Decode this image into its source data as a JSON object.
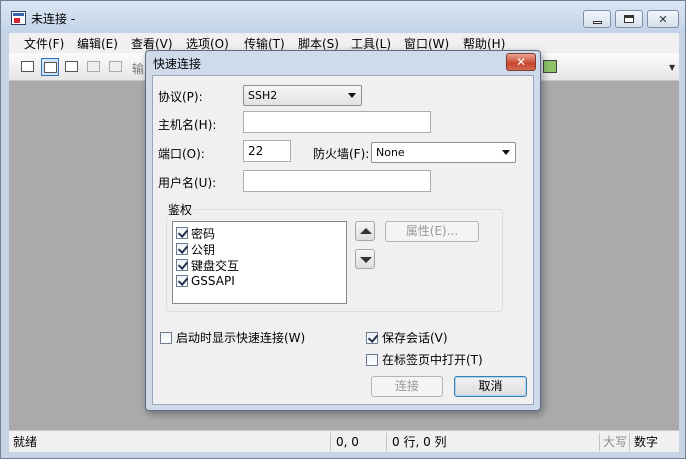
{
  "window": {
    "title": "未连接 -",
    "minimize_label": "",
    "maximize_label": "",
    "close_label": "✕"
  },
  "menu": [
    {
      "label": "文件(F)"
    },
    {
      "label": "编辑(E)"
    },
    {
      "label": "查看(V)"
    },
    {
      "label": "选项(O)"
    },
    {
      "label": "传输(T)"
    },
    {
      "label": "脚本(S)"
    },
    {
      "label": "工具(L)"
    },
    {
      "label": "窗口(W)"
    },
    {
      "label": "帮助(H)"
    }
  ],
  "toolbar": {
    "partial_text": "输"
  },
  "status_bar": {
    "ready": "就绪",
    "position": "0, 0",
    "rowcol": "0 行, 0 列",
    "caps": "大写",
    "num": "数字"
  },
  "dialog": {
    "title": "快速连接",
    "close_label": "✕",
    "protocol_label": "协议(P):",
    "protocol_value": "SSH2",
    "hostname_label": "主机名(H):",
    "hostname_value": "",
    "port_label": "端口(O):",
    "port_value": "22",
    "firewall_label": "防火墙(F):",
    "firewall_value": "None",
    "username_label": "用户名(U):",
    "username_value": "",
    "auth_group_label": "鉴权",
    "auth_methods": [
      {
        "label": "密码",
        "checked": true
      },
      {
        "label": "公钥",
        "checked": true
      },
      {
        "label": "键盘交互",
        "checked": true
      },
      {
        "label": "GSSAPI",
        "checked": true
      }
    ],
    "properties_button": "属性(E)...",
    "show_on_startup_label": "启动时显示快速连接(W)",
    "show_on_startup_checked": false,
    "save_session_label": "保存会话(V)",
    "save_session_checked": true,
    "open_in_tab_label": "在标签页中打开(T)",
    "open_in_tab_checked": false,
    "connect_button": "连接",
    "cancel_button": "取消"
  }
}
